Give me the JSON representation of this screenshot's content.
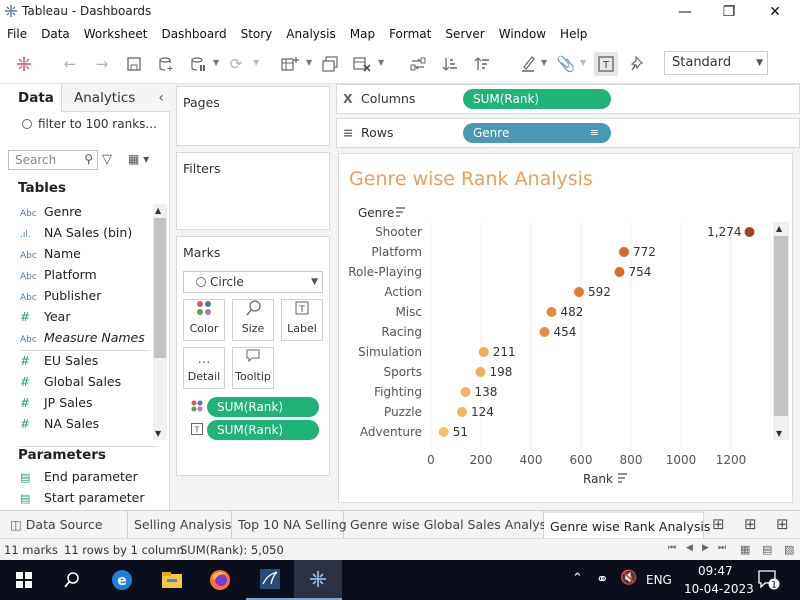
{
  "window": {
    "title": "Tableau - Dashboards",
    "minimize_icon": "minimize-icon",
    "maximize_icon": "restore-icon",
    "close_icon": "close-icon"
  },
  "menu": [
    "File",
    "Data",
    "Worksheet",
    "Dashboard",
    "Story",
    "Analysis",
    "Map",
    "Format",
    "Server",
    "Window",
    "Help"
  ],
  "toolbar": {
    "fit_mode": "Standard",
    "icons": [
      "tableau-logo-icon",
      "back-icon",
      "forward-icon",
      "save-icon",
      "new-datasource-icon",
      "pause-updates-icon",
      "refresh-icon",
      "new-worksheet-icon",
      "duplicate-icon",
      "clear-sheet-icon",
      "swap-icon",
      "sort-ascending-icon",
      "sort-descending-icon",
      "highlight-icon",
      "group-icon",
      "show-labels-icon",
      "fix-axes-icon"
    ]
  },
  "data_pane": {
    "tab_data": "Data",
    "tab_analytics": "Analytics",
    "datasource": "filter to 100 ranks...",
    "search_placeholder": "Search",
    "tables_heading": "Tables",
    "fields": [
      {
        "type": "Abc",
        "name": "Genre"
      },
      {
        "type": "bin",
        "name": "NA Sales (bin)"
      },
      {
        "type": "Abc",
        "name": "Name"
      },
      {
        "type": "Abc",
        "name": "Platform"
      },
      {
        "type": "Abc",
        "name": "Publisher"
      },
      {
        "type": "#",
        "name": "Year"
      },
      {
        "type": "Abc",
        "name": "Measure Names"
      },
      {
        "type": "#",
        "name": "EU Sales"
      },
      {
        "type": "#",
        "name": "Global Sales"
      },
      {
        "type": "#",
        "name": "JP Sales"
      },
      {
        "type": "#",
        "name": "NA Sales"
      }
    ],
    "parameters_heading": "Parameters",
    "parameters": [
      "End parameter",
      "Start parameter"
    ]
  },
  "cards": {
    "pages": "Pages",
    "filters": "Filters",
    "marks": "Marks",
    "mark_type": "Circle",
    "buttons": {
      "color": "Color",
      "size": "Size",
      "label": "Label",
      "detail": "Detail",
      "tooltip": "Tooltip"
    },
    "color_pill": "SUM(Rank)",
    "label_pill": "SUM(Rank)"
  },
  "shelves": {
    "columns_label": "Columns",
    "columns_pill": "SUM(Rank)",
    "rows_label": "Rows",
    "rows_pill": "Genre"
  },
  "sheet": {
    "title": "Genre wise Rank Analysis"
  },
  "chart_data": {
    "type": "scatter",
    "title": "Genre wise Rank Analysis",
    "ylabel": "Genre",
    "xlabel": "Rank",
    "xlim": [
      0,
      1300
    ],
    "x_ticks": [
      0,
      200,
      400,
      600,
      800,
      1000,
      1200
    ],
    "grid": true,
    "color_encoding": "SUM(Rank)",
    "colors": {
      "low": "#f0c26a",
      "mid": "#e4712f",
      "high": "#a33f24"
    },
    "categories": [
      "Shooter",
      "Platform",
      "Role-Playing",
      "Action",
      "Misc",
      "Racing",
      "Simulation",
      "Sports",
      "Fighting",
      "Puzzle",
      "Adventure"
    ],
    "values": [
      1274,
      772,
      754,
      592,
      482,
      454,
      211,
      198,
      138,
      124,
      51
    ],
    "labels": [
      "1,274",
      "772",
      "754",
      "592",
      "482",
      "454",
      "211",
      "198",
      "138",
      "124",
      "51"
    ]
  },
  "sheet_tabs": [
    "Data Source",
    "Selling Analysis",
    "Top 10 NA Selling",
    "Genre wise Global Sales Analysis",
    "Genre wise Rank Analysis"
  ],
  "active_sheet": "Genre wise Rank Analysis",
  "status": {
    "marks": "11 marks",
    "rows_cols": "11 rows by 1 column",
    "sum": "SUM(Rank): 5,050"
  },
  "taskbar": {
    "time": "09:47",
    "date": "10-04-2023",
    "language": "ENG",
    "notifications": "1"
  }
}
